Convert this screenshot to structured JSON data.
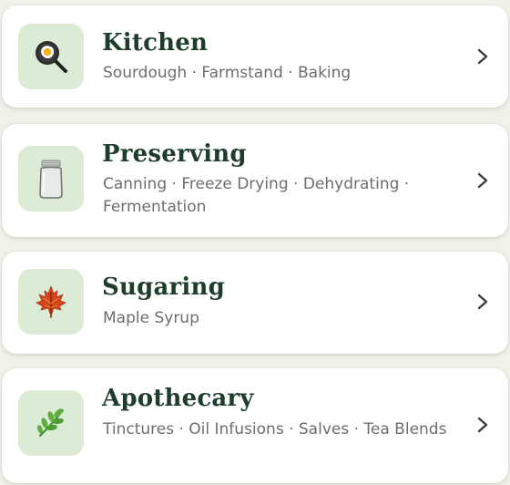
{
  "colors": {
    "background": "#f1f2ea",
    "card": "#ffffff",
    "icon_tile": "#dcebd5",
    "title": "#1f3d2c",
    "subtitle": "#6a7069",
    "chevron": "#3a3f3a"
  },
  "categories": [
    {
      "title": "Kitchen",
      "subtitle": "Sourdough · Farmstand · Baking",
      "icon": "frying-pan-egg-icon"
    },
    {
      "title": "Preserving",
      "subtitle": "Canning · Freeze Drying · Dehydrating · Fermentation",
      "icon": "mason-jar-icon"
    },
    {
      "title": "Sugaring",
      "subtitle": "Maple Syrup",
      "icon": "maple-leaf-icon"
    },
    {
      "title": "Apothecary",
      "subtitle": "Tinctures · Oil Infusions · Salves · Tea Blends",
      "icon": "herb-icon"
    }
  ]
}
